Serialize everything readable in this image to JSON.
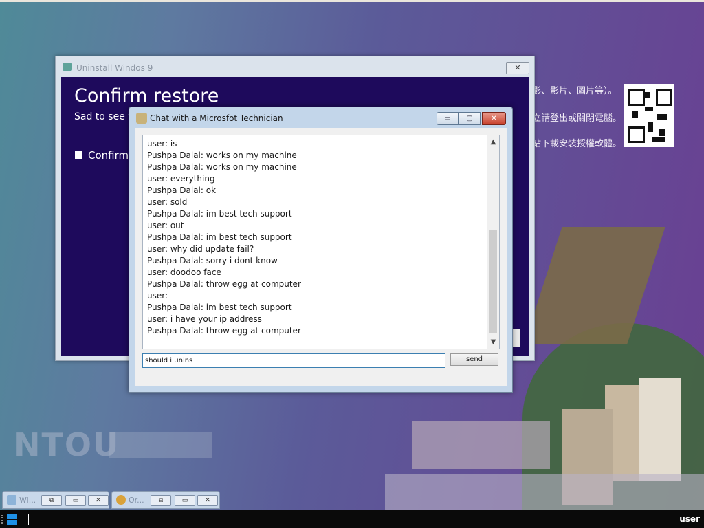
{
  "wallpaper": {
    "notice_lines": [
      "影、影片、圖片等）。",
      "立請登出或關閉電腦。",
      "站下載安裝授權軟體。"
    ],
    "logo_text": "NTOU"
  },
  "bg_window": {
    "title": "Uninstall Windos 9",
    "heading": "Confirm restore",
    "subtitle": "Sad to see y",
    "checkbox_label": "Confirm",
    "close_glyph": "✕"
  },
  "chat_window": {
    "title": "Chat with a Microsfot Technician",
    "buttons": {
      "minimize": "▭",
      "maximize": "▢",
      "close": "✕"
    },
    "messages": [
      "user: is",
      "Pushpa Dalal: works on my machine",
      "Pushpa Dalal: works on my machine",
      "user: everything",
      "Pushpa Dalal: ok",
      "user: sold",
      "Pushpa Dalal: im best tech support",
      "user: out",
      "Pushpa Dalal: im best tech support",
      "user: why did update fail?",
      "Pushpa Dalal: sorry i dont know",
      "user: doodoo face",
      "Pushpa Dalal: throw egg at computer",
      "user:",
      "Pushpa Dalal: im best tech support",
      "user: i have your ip address",
      "Pushpa Dalal: throw egg at computer"
    ],
    "input_value": "should i unins",
    "send_label": "send",
    "scroll_up": "▲",
    "scroll_down": "▼"
  },
  "minimized": [
    {
      "label": "Wi...",
      "icon": "app-icon"
    },
    {
      "label": "Or...",
      "icon": "burger-icon"
    }
  ],
  "mini_buttons": {
    "restore": "⧉",
    "max": "▭",
    "close": "✕"
  },
  "taskbar": {
    "user_label": "user"
  },
  "colors": {
    "panel": "#1e0a5c",
    "desktop_left": "#4f8a98",
    "desktop_right": "#6a3f92"
  }
}
